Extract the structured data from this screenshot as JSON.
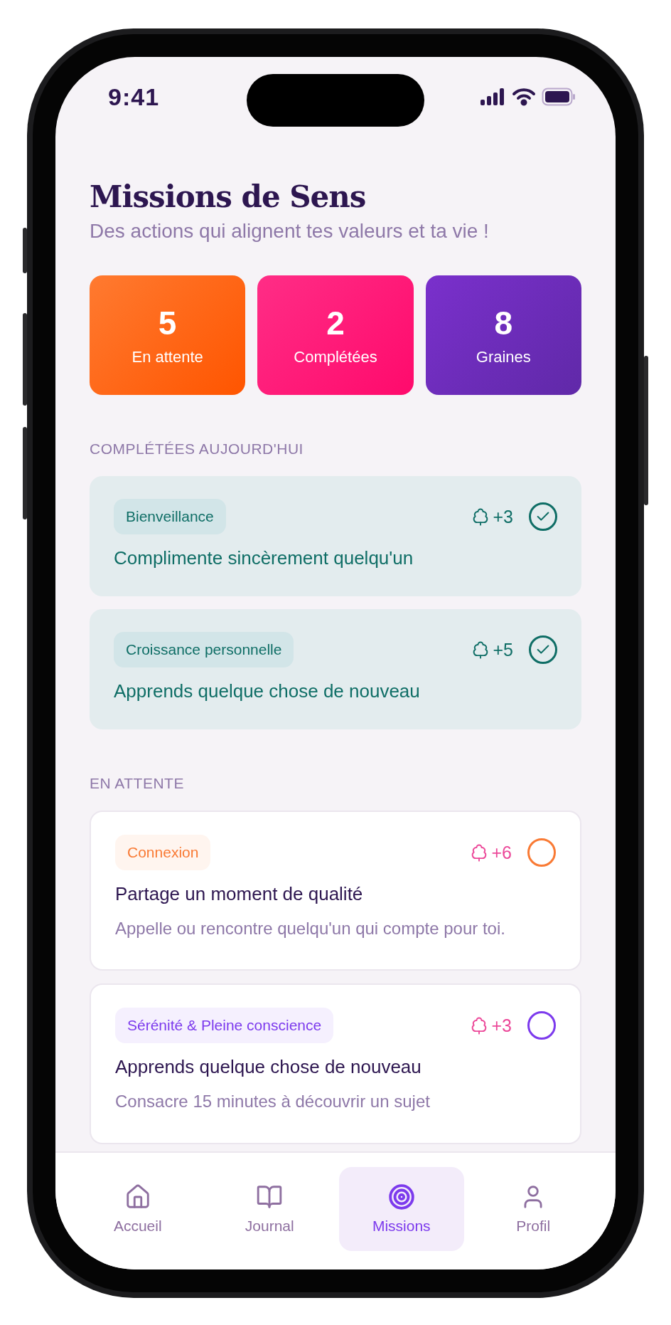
{
  "status_bar": {
    "time": "9:41"
  },
  "header": {
    "title": "Missions de Sens",
    "subtitle": "Des actions qui alignent tes valeurs et ta vie !"
  },
  "stats": [
    {
      "value": "5",
      "label": "En attente",
      "kind": "orange"
    },
    {
      "value": "2",
      "label": "Complétées",
      "kind": "pink"
    },
    {
      "value": "8",
      "label": "Graines",
      "kind": "purple"
    }
  ],
  "completed": {
    "heading": "COMPLÉTÉES AUJOURD'HUI",
    "missions": [
      {
        "tag": "Bienveillance",
        "seeds": "+3",
        "title": "Complimente sincèrement quelqu'un",
        "done": true,
        "color": "#0f6e66"
      },
      {
        "tag": "Croissance personnelle",
        "seeds": "+5",
        "title": "Apprends quelque chose de nouveau",
        "done": true,
        "color": "#0f6e66"
      }
    ]
  },
  "pending": {
    "heading": "EN ATTENTE",
    "missions": [
      {
        "tag": "Connexion",
        "seeds": "+6",
        "title": "Partage un moment de qualité",
        "description": "Appelle ou rencontre quelqu'un qui compte pour toi.",
        "done": false,
        "color": "#f97a34"
      },
      {
        "tag": "Sérénité & Pleine conscience",
        "seeds": "+3",
        "title": "Apprends quelque chose de nouveau",
        "description": "Consacre 15 minutes à découvrir un sujet",
        "done": false,
        "color": "#7c3aed"
      }
    ]
  },
  "nav": [
    {
      "label": "Accueil",
      "kind": "home",
      "selected": false
    },
    {
      "label": "Journal",
      "kind": "book",
      "selected": false
    },
    {
      "label": "Missions",
      "kind": "target",
      "selected": true
    },
    {
      "label": "Profil",
      "kind": "user",
      "selected": false
    }
  ]
}
